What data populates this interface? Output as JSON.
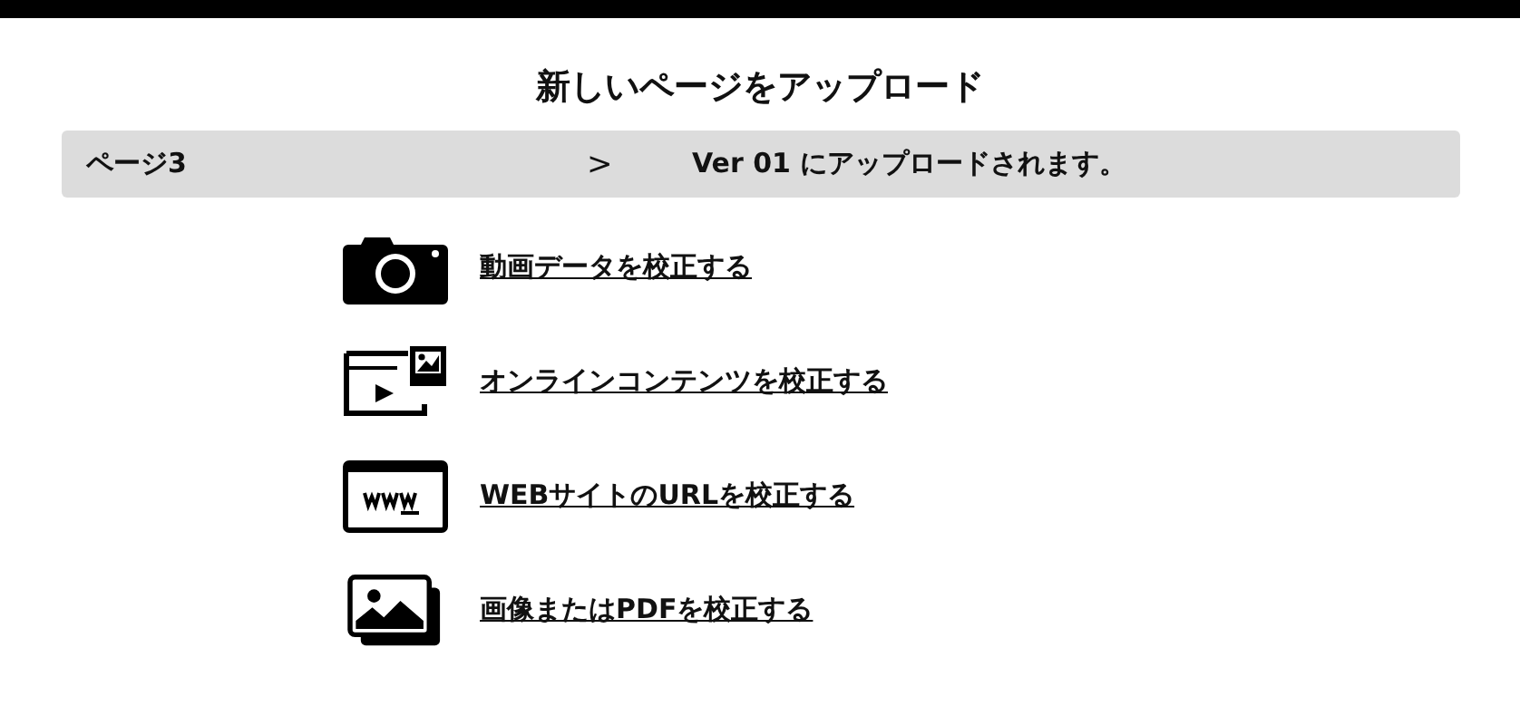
{
  "title": "新しいページをアップロード",
  "info_bar": {
    "page": "ページ3",
    "separator": ">",
    "target": "Ver 01 にアップロードされます。"
  },
  "options": [
    {
      "kind": "camera",
      "label": "動画データを校正する"
    },
    {
      "kind": "media",
      "label": "オンラインコンテンツを校正する"
    },
    {
      "kind": "web",
      "label": "WEBサイトのURLを校正する"
    },
    {
      "kind": "images",
      "label": "画像またはPDFを校正する"
    }
  ]
}
